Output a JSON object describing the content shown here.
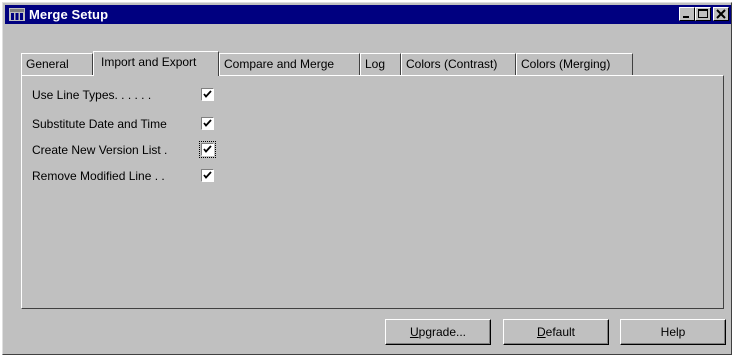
{
  "window": {
    "title": "Merge Setup",
    "minimize_label": "_",
    "maximize_label": "□",
    "close_label": "X"
  },
  "tabs": [
    {
      "label": "General"
    },
    {
      "label": "Import and Export",
      "active": true
    },
    {
      "label": "Compare and Merge"
    },
    {
      "label": "Log"
    },
    {
      "label": "Colors (Contrast)"
    },
    {
      "label": "Colors (Merging)"
    }
  ],
  "options": [
    {
      "label": "Use Line Types. . . . . .",
      "checked": true
    },
    {
      "label": "Substitute Date and Time",
      "checked": true
    },
    {
      "label": "Create New Version List .",
      "checked": true,
      "focused": true
    },
    {
      "label": "Remove Modified Line . .",
      "checked": true
    }
  ],
  "buttons": {
    "upgrade": {
      "prefix": "",
      "mnemonic": "U",
      "rest": "pgrade..."
    },
    "default": {
      "prefix": "",
      "mnemonic": "D",
      "rest": "efault"
    },
    "help": {
      "label": "Help"
    }
  }
}
